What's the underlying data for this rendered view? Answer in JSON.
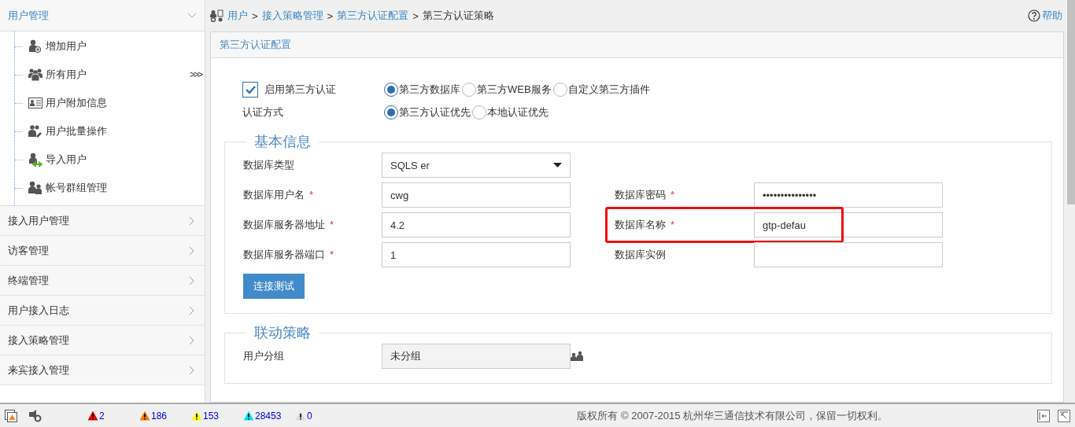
{
  "sidebar": {
    "groups": [
      {
        "label": "用户管理",
        "expanded": true,
        "children": [
          {
            "label": "增加用户"
          },
          {
            "label": "所有用户",
            "more": ">>>"
          },
          {
            "label": "用户附加信息"
          },
          {
            "label": "用户批量操作"
          },
          {
            "label": "导入用户"
          },
          {
            "label": "帐号群组管理"
          }
        ]
      },
      {
        "label": "接入用户管理",
        "expanded": false
      },
      {
        "label": "访客管理",
        "expanded": false
      },
      {
        "label": "终端管理",
        "expanded": false
      },
      {
        "label": "用户接入日志",
        "expanded": false
      },
      {
        "label": "接入策略管理",
        "expanded": false
      },
      {
        "label": "来宾接入管理",
        "expanded": false
      }
    ]
  },
  "breadcrumb": [
    {
      "label": "用户",
      "link": true
    },
    {
      "label": "接入策略管理",
      "link": true
    },
    {
      "label": "第三方认证配置",
      "link": true
    },
    {
      "label": "第三方认证策略",
      "link": false
    }
  ],
  "breadcrumb_separator": ">",
  "help": "帮助",
  "panel": {
    "title": "第三方认证配置",
    "enable": {
      "label": "启用第三方认证",
      "checked": true
    },
    "source_options": [
      {
        "label": "第三方数据库",
        "selected": true
      },
      {
        "label": "第三方WEB服务",
        "selected": false
      },
      {
        "label": "自定义第三方插件",
        "selected": false
      }
    ],
    "auth_mode": {
      "label": "认证方式",
      "options": [
        {
          "label": "第三方认证优先",
          "selected": true
        },
        {
          "label": "本地认证优先",
          "selected": false
        }
      ]
    },
    "basic_info": {
      "legend": "基本信息",
      "rows": [
        {
          "cells": [
            {
              "label": "数据库类型",
              "kind": "select",
              "value": "SQLS er"
            }
          ]
        },
        {
          "cells": [
            {
              "label": "数据库用户名",
              "required_mark": "*",
              "kind": "text",
              "value": "cwg"
            },
            {
              "label": "数据库密码",
              "required_mark": "*",
              "kind": "password",
              "value": "•••••••••••••••"
            }
          ]
        },
        {
          "cells": [
            {
              "label": "数据库服务器地址",
              "required_mark": "*",
              "kind": "text",
              "value": "4.2"
            },
            {
              "label": "数据库名称",
              "required_mark": "*",
              "kind": "text",
              "value": "gtp-defau",
              "highlighted": true
            }
          ]
        },
        {
          "cells": [
            {
              "label": "数据库服务器端口",
              "required_mark": "*",
              "kind": "text",
              "value": "1"
            },
            {
              "label": "数据库实例",
              "kind": "text"
            }
          ]
        }
      ],
      "button": "连接测试"
    },
    "linkage": {
      "legend": "联动策略",
      "rows": [
        {
          "cells": [
            {
              "label": "用户分组",
              "value": "未分组",
              "disabled": true
            }
          ]
        }
      ]
    }
  },
  "status_bar": {
    "alerts": [
      {
        "count": "2",
        "color": "#e60000"
      },
      {
        "count": "186",
        "color": "#ff7700"
      },
      {
        "count": "153",
        "color": "#ffff00"
      },
      {
        "count": "28453",
        "color": "#00e5ee"
      },
      {
        "count": "0",
        "color": "#dddddd"
      }
    ],
    "copyright": "版权所有 © 2007-2015 杭州华三通信技术有限公司，保留一切权利。"
  }
}
